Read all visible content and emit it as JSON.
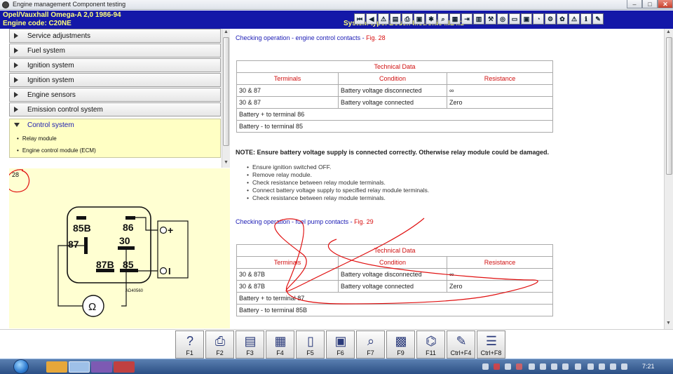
{
  "window": {
    "title": "Engine management Component testing",
    "min_label": "–",
    "max_label": "□",
    "close_label": "✕"
  },
  "header": {
    "vehicle": "Opel/Vauxhall   Omega-A  2,0  1986-94",
    "engine_code": "Engine code: C20NE",
    "system_type": "System type: Bosch Motronic ML4.1"
  },
  "toolbar_icons": [
    "first-page-icon",
    "back-icon",
    "warning-icon",
    "document-icon",
    "print-icon",
    "folder-icon",
    "lightbulb-icon",
    "search-icon",
    "calculator-icon",
    "exit-icon",
    "chart-icon",
    "wrench-icon",
    "brake-icon",
    "monitor-icon",
    "screen-icon",
    "stopwatch-icon",
    "tools-icon",
    "gear-icon",
    "warning-triangle-icon",
    "info-icon",
    "note-icon"
  ],
  "sidebar": {
    "items": [
      {
        "label": "Service adjustments"
      },
      {
        "label": "Fuel system"
      },
      {
        "label": "Ignition system"
      },
      {
        "label": "Ignition system"
      },
      {
        "label": "Engine sensors"
      },
      {
        "label": "Emission control system"
      }
    ],
    "active": {
      "label": "Control system",
      "children": [
        "Relay module",
        "Engine control module (ECM)"
      ]
    }
  },
  "figure": {
    "number": "28",
    "labels": {
      "t85b": "85B",
      "t86": "86",
      "t87": "87",
      "t30": "30",
      "t87b": "87B",
      "t85": "85",
      "code": "AD40560",
      "plus": "+",
      "minus": "I",
      "ohm": "Ω"
    }
  },
  "section1": {
    "title": "Checking operation - engine control contacts - ",
    "fig": "Fig. 28",
    "table": {
      "caption": "Technical Data",
      "headers": [
        "Terminals",
        "Condition",
        "Resistance"
      ],
      "rows": [
        [
          "30 & 87",
          "Battery voltage disconnected",
          "∞"
        ],
        [
          "30 & 87",
          "Battery voltage connected",
          "Zero"
        ]
      ],
      "notes": [
        "Battery + to terminal 86",
        "Battery - to terminal 85"
      ]
    }
  },
  "note": "NOTE: Ensure battery voltage supply is connected correctly. Otherwise relay module could be damaged.",
  "steps": [
    "Ensure ignition switched OFF.",
    "Remove relay module.",
    "Check resistance between relay module terminals.",
    "Connect battery voltage supply to specified relay module terminals.",
    "Check resistance between relay module terminals."
  ],
  "section2": {
    "title": "Checking operation - fuel pump contacts - ",
    "fig": "Fig. 29",
    "table": {
      "caption": "Technical Data",
      "headers": [
        "Terminals",
        "Condition",
        "Resistance"
      ],
      "rows": [
        [
          "30 & 87B",
          "Battery voltage disconnected",
          "∞"
        ],
        [
          "30 & 87B",
          "Battery voltage connected",
          "Zero"
        ]
      ],
      "notes": [
        "Battery + to terminal 87",
        "Battery - to terminal 85B"
      ]
    }
  },
  "fkeys": [
    {
      "label": "F1",
      "icon": "help-icon",
      "glyph": "?"
    },
    {
      "label": "F2",
      "icon": "printer-icon",
      "glyph": "⎙"
    },
    {
      "label": "F3",
      "icon": "document-folder-icon",
      "glyph": "▤"
    },
    {
      "label": "F4",
      "icon": "document-edit-icon",
      "glyph": "▦"
    },
    {
      "label": "F5",
      "icon": "page-icon",
      "glyph": "▯"
    },
    {
      "label": "F6",
      "icon": "component-icon",
      "glyph": "▣"
    },
    {
      "label": "F7",
      "icon": "magnifier-icon",
      "glyph": "⌕"
    },
    {
      "label": "F9",
      "icon": "wiring-diagram-icon",
      "glyph": "▩"
    },
    {
      "label": "F11",
      "icon": "circuit-search-icon",
      "glyph": "⌬"
    },
    {
      "label": "Ctrl+F4",
      "icon": "pencil-icon",
      "glyph": "✎"
    },
    {
      "label": "Ctrl+F8",
      "icon": "list-icon",
      "glyph": "☰"
    }
  ],
  "taskbar": {
    "clock": "7:21",
    "icons": [
      "media-player-icon",
      "file-explorer-icon",
      "visual-studio-icon",
      "browser-icon"
    ]
  },
  "colors": {
    "header_bg": "#1418a8",
    "header_text": "#ffff7a",
    "link_blue": "#1a1ab4",
    "accent_red": "#d81010",
    "figure_bg": "#ffffd2",
    "annotation_red": "#e01010"
  }
}
